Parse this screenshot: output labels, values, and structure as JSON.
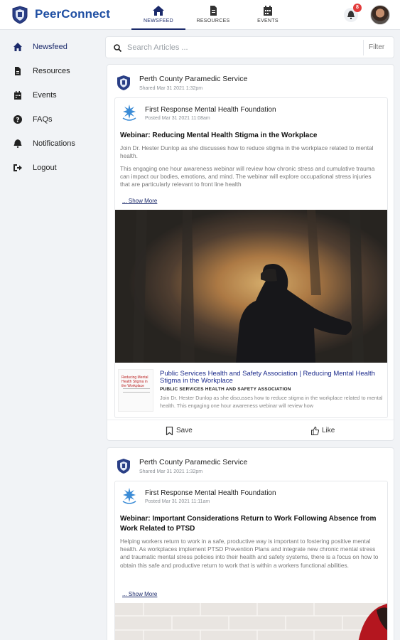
{
  "app": {
    "brand": "PeerConnect"
  },
  "nav": {
    "tabs": [
      {
        "label": "NEWSFEED",
        "icon": "home-icon"
      },
      {
        "label": "RESOURCES",
        "icon": "document-icon"
      },
      {
        "label": "EVENTS",
        "icon": "calendar-icon"
      }
    ],
    "notifications_count": "8"
  },
  "sidebar": {
    "items": [
      {
        "label": "Newsfeed",
        "icon": "home-icon"
      },
      {
        "label": "Resources",
        "icon": "document-icon"
      },
      {
        "label": "Events",
        "icon": "calendar-icon"
      },
      {
        "label": "FAQs",
        "icon": "question-icon"
      },
      {
        "label": "Notifications",
        "icon": "bell-icon"
      },
      {
        "label": "Logout",
        "icon": "logout-icon"
      }
    ]
  },
  "search": {
    "placeholder": "Search Articles ...",
    "filter_label": "Filter"
  },
  "posts": [
    {
      "org": "Perth County Paramedic Service",
      "shared": "Shared Mar 31 2021 1:32pm",
      "inner": {
        "org": "First Response Mental Health Foundation",
        "posted": "Posted Mar 31 2021 11:08am",
        "title": "Webinar: Reducing Mental Health Stigma in the Workplace",
        "body1": "Join Dr. Hester Dunlop as she discusses how to reduce stigma in the workplace related to mental health.",
        "body2": "This engaging one hour awareness webinar will review how chronic stress and cumulative trauma can impact our bodies, emotions, and mind. The webinar will explore occupational stress injuries that are particularly relevant to front line health",
        "show_more": "... Show More",
        "link": {
          "thumb_text": "Reducing Mental Health Stigma in the Workplace",
          "title": "Public Services Health and Safety Association | Reducing Mental Health Stigma in the Workplace",
          "source": "PUBLIC SERVICES HEALTH AND SAFETY ASSOCIATION",
          "desc": "Join Dr. Hester Dunlop as she discusses how to reduce stigma in the workplace related to mental health. This engaging one hour awareness webinar will review how"
        }
      },
      "save_label": "Save",
      "like_label": "Like"
    },
    {
      "org": "Perth County Paramedic Service",
      "shared": "Shared Mar 31 2021 1:32pm",
      "inner": {
        "org": "First Response Mental Health Foundation",
        "posted": "Posted Mar 31 2021 11:11am",
        "title": "Webinar: Important Considerations Return to Work Following Absence from Work Related to PTSD",
        "body1": "Helping workers return to work in a safe, productive way is important to fostering positive mental health. As workplaces implement PTSD Prevention Plans and integrate new chronic mental stress and traumatic mental stress policies into their health and safety systems, there is a focus on how to obtain this safe and productive return to work that is within a workers functional abilities.",
        "show_more": "... Show More"
      }
    }
  ],
  "colors": {
    "brand": "#1f4fa3",
    "nav_active": "#1b2a6b",
    "badge": "#e23b3b"
  }
}
